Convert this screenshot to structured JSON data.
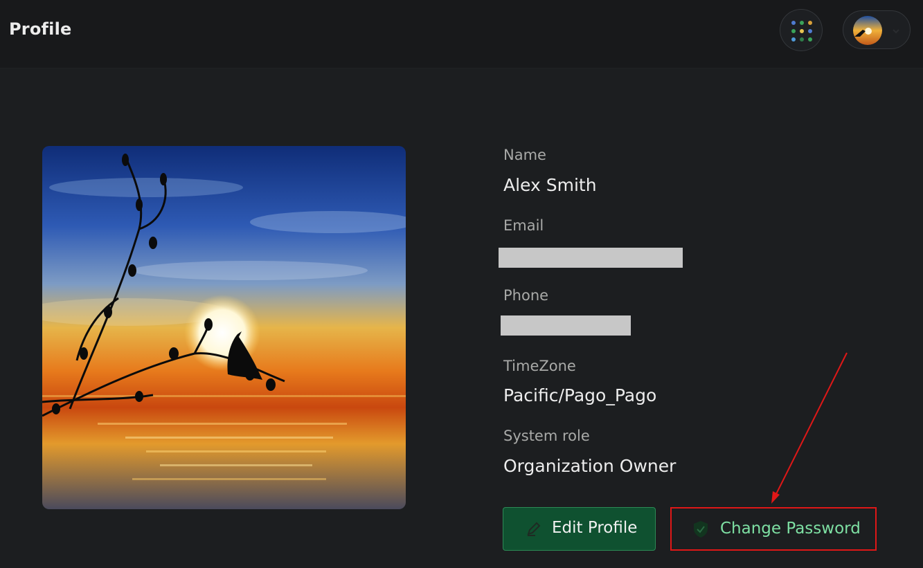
{
  "header": {
    "title": "Profile",
    "apps_icon": "apps-grid-icon",
    "user_avatar_icon": "avatar",
    "user_menu_chevron_icon": "chevron-down-icon"
  },
  "profile": {
    "photo_alt": "Profile photo",
    "fields": [
      {
        "label": "Name",
        "value": "Alex Smith"
      },
      {
        "label": "Email",
        "value": ""
      },
      {
        "label": "Phone",
        "value": ""
      },
      {
        "label": "TimeZone",
        "value": "Pacific/Pago_Pago"
      },
      {
        "label": "System role",
        "value": "Organization Owner"
      }
    ]
  },
  "actions": {
    "edit_label": "Edit Profile",
    "edit_icon": "pencil-icon",
    "change_password_label": "Change Password",
    "change_password_icon": "shield-check-icon"
  },
  "colors": {
    "background": "#1c1e20",
    "topbar": "#18191b",
    "primary_button": "#0f5130",
    "accent_text": "#7ee0a3",
    "annotation": "#e01717"
  }
}
